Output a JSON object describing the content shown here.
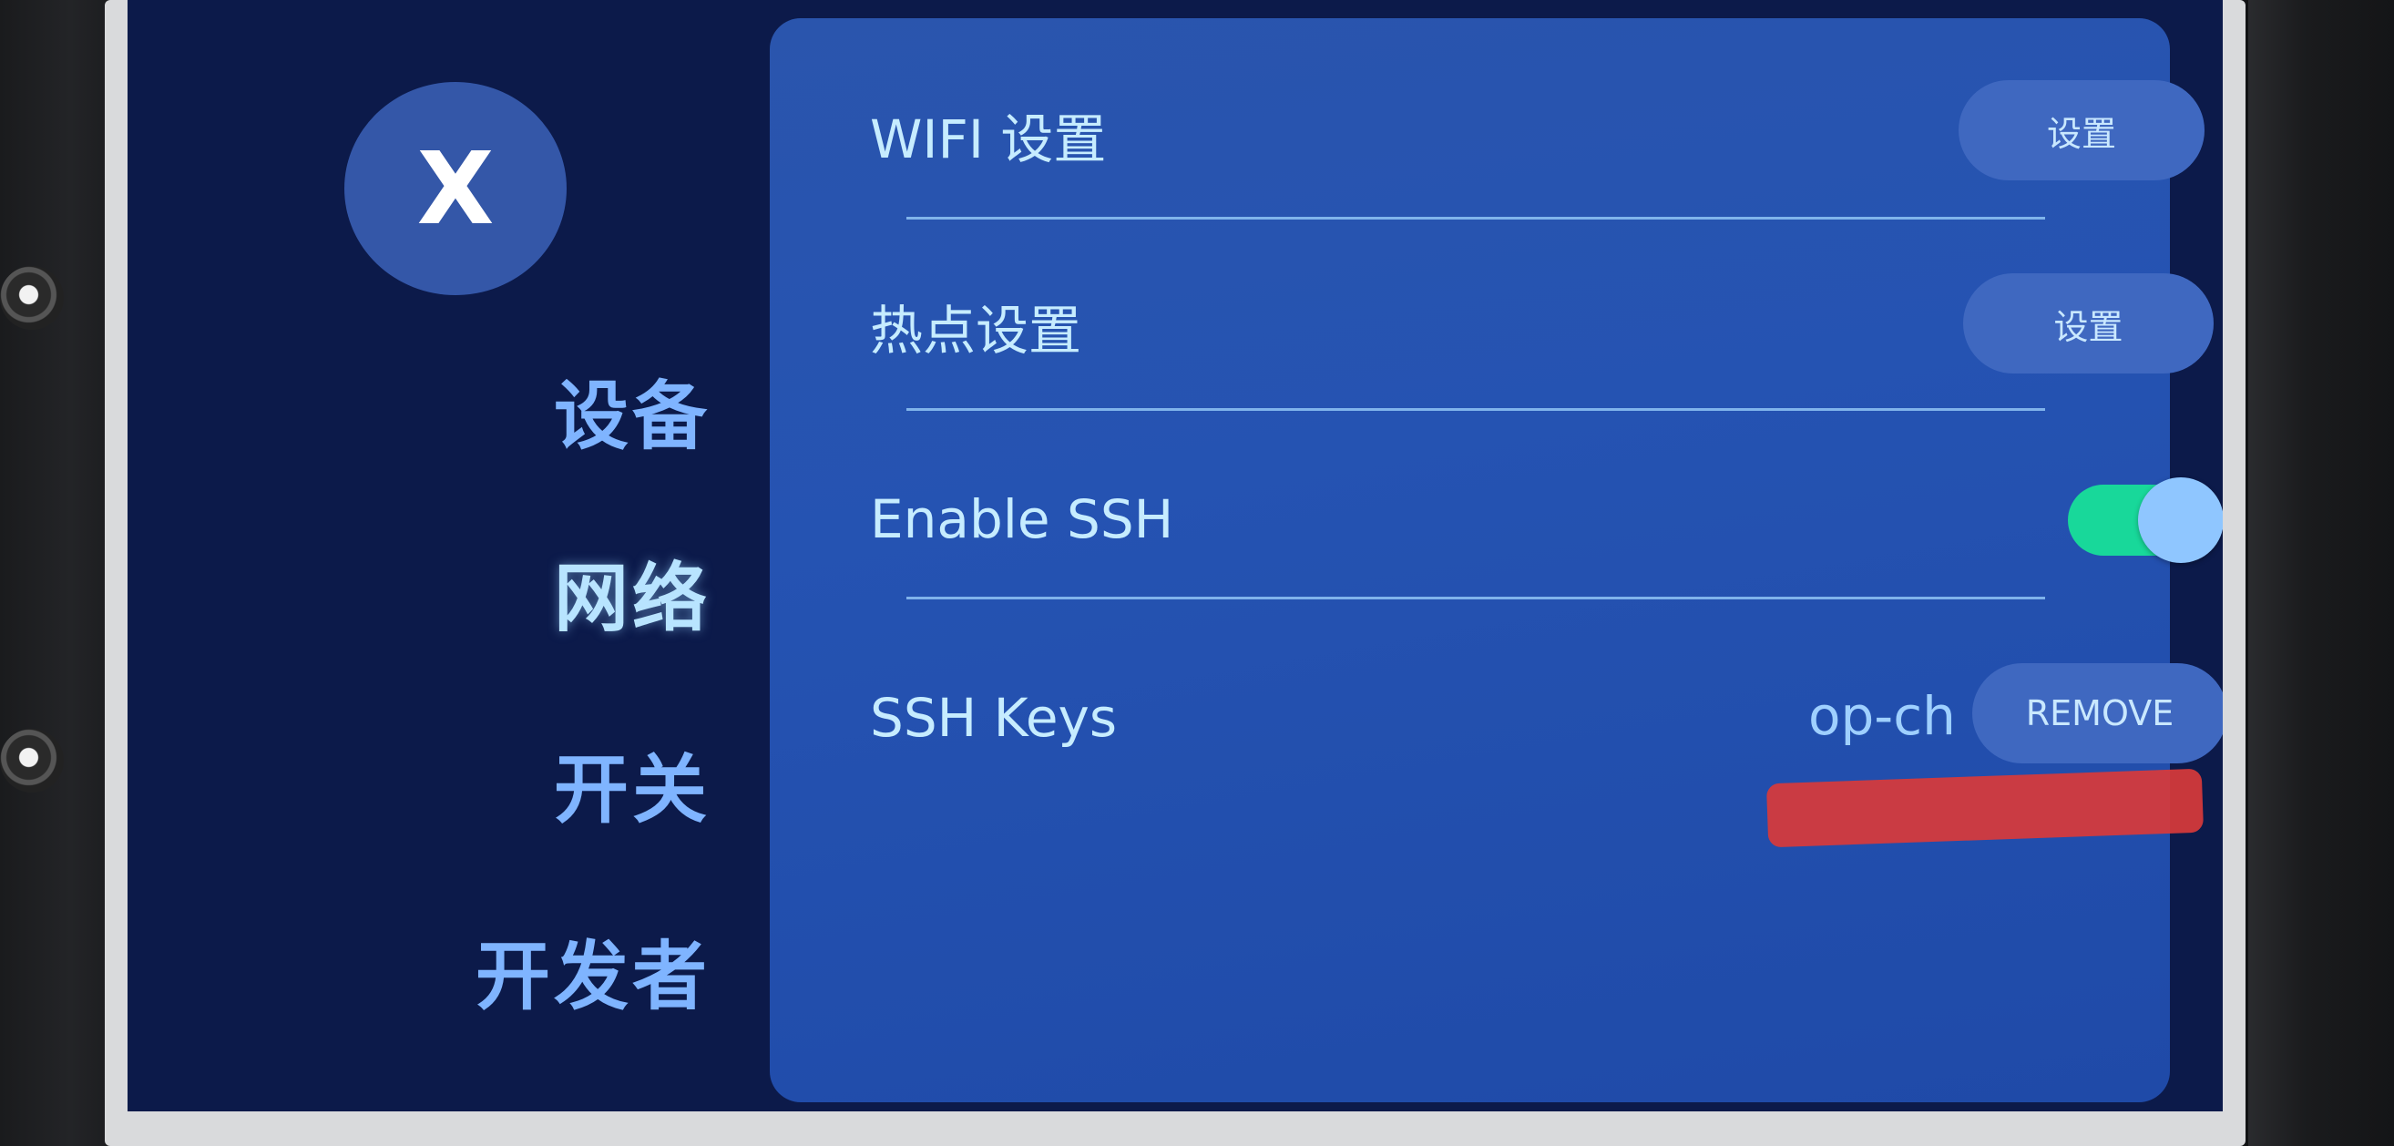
{
  "close_button": {
    "label": "X"
  },
  "nav": {
    "items": [
      {
        "label": "设备",
        "active": false
      },
      {
        "label": "网络",
        "active": true
      },
      {
        "label": "开关",
        "active": false
      },
      {
        "label": "开发者",
        "active": false
      }
    ]
  },
  "settings": {
    "wifi": {
      "label": "WIFI 设置",
      "button_label": "设置"
    },
    "hotspot": {
      "label": "热点设置",
      "button_label": "设置"
    },
    "ssh": {
      "label": "Enable SSH",
      "enabled": true
    },
    "ssh_keys": {
      "label": "SSH Keys",
      "username": "op-ch",
      "button_label": "REMOVE"
    }
  },
  "colors": {
    "panel": "#2553b2",
    "toggle_on": "#18d89a",
    "accent_text": "#c6ecff"
  }
}
